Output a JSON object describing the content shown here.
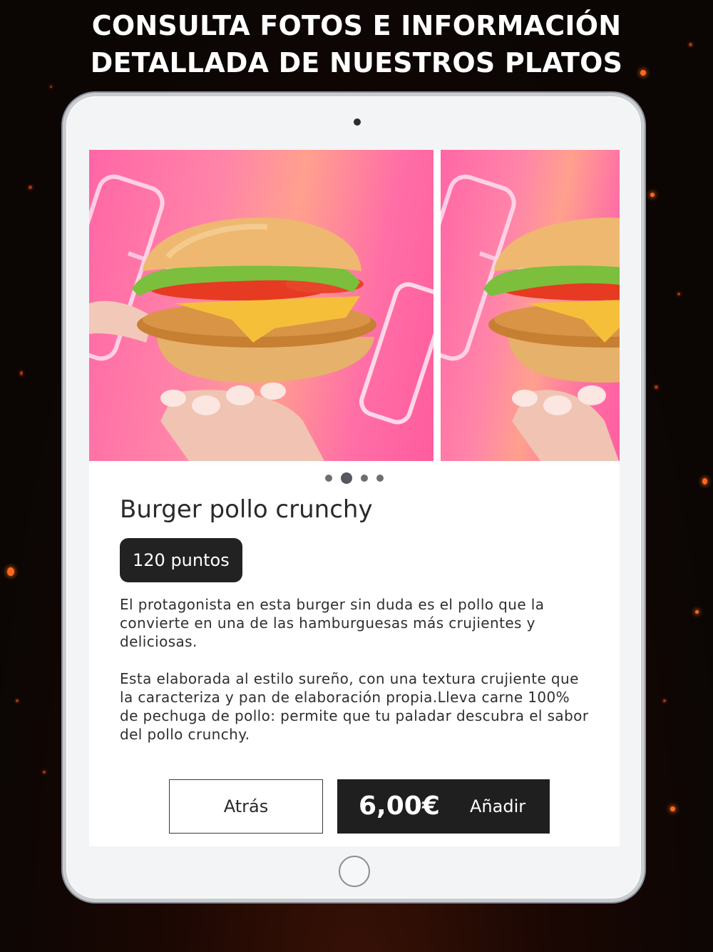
{
  "headline": {
    "line1": "CONSULTA FOTOS E INFORMACIÓN",
    "line2": "DETALLADA DE NUESTROS PLATOS"
  },
  "product": {
    "title": "Burger pollo crunchy",
    "points": "120 puntos",
    "description": [
      "El protagonista en esta burger sin duda es el pollo que la convierte en una de las hamburguesas más crujientes y deliciosas.",
      "Esta elaborada al estilo sureño, con una textura crujiente que la caracteriza y pan de elaboración propia.Lleva carne 100% de pechuga de pollo: permite que tu paladar descubra el sabor del pollo crunchy."
    ]
  },
  "gallery": {
    "slide_count": 4,
    "active_index": 1
  },
  "actions": {
    "back_label": "Atrás",
    "price": "6,00€",
    "add_label": "Añadir"
  },
  "colors": {
    "button_dark": "#1f1f1f",
    "badge_dark": "#222222",
    "photo_pink": "#ff66a6",
    "ember_orange": "#ff6a1a"
  }
}
